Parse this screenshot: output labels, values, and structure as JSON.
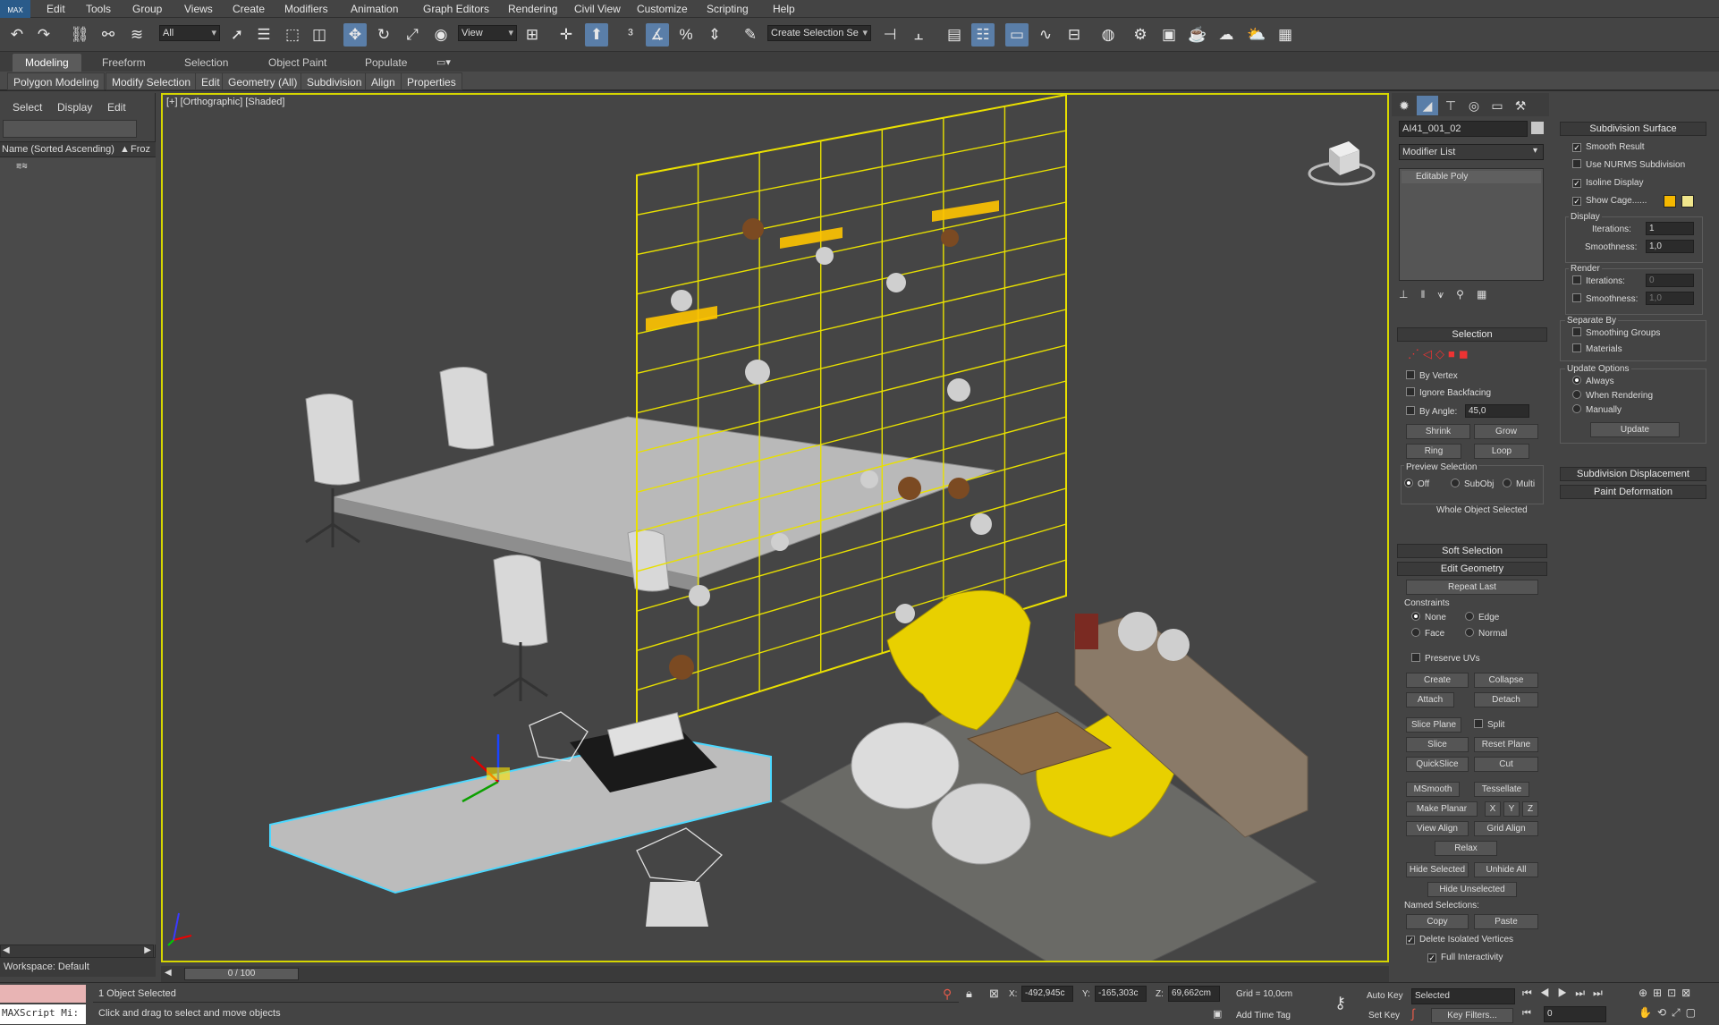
{
  "menu": [
    "Edit",
    "Tools",
    "Group",
    "Views",
    "Create",
    "Modifiers",
    "Animation",
    "Graph Editors",
    "Rendering",
    "Civil View",
    "Customize",
    "Scripting",
    "Help"
  ],
  "app_logo": "MAX",
  "toolbar": {
    "filter": "All",
    "ref_coord": "View",
    "selection_set": "Create Selection Se"
  },
  "ribbon": {
    "tabs": [
      "Modeling",
      "Freeform",
      "Selection",
      "Object Paint",
      "Populate"
    ],
    "items": [
      "Polygon Modeling",
      "Modify Selection",
      "Edit",
      "Geometry (All)",
      "Subdivision",
      "Align",
      "Properties"
    ]
  },
  "scene_explorer": {
    "tabs": [
      "Select",
      "Display",
      "Edit"
    ],
    "col_name": "Name (Sorted Ascending)",
    "col_frozen": "Froz",
    "workspace": "Workspace: Default"
  },
  "viewport": {
    "label": "[+] [Orthographic] [Shaded]",
    "time": "0 / 100"
  },
  "modify": {
    "object_name": "AI41_001_02",
    "modifier_list": "Modifier List",
    "stack_item": "Editable Poly",
    "selection": {
      "title": "Selection",
      "by_vertex": "By Vertex",
      "ignore_backfacing": "Ignore Backfacing",
      "by_angle": "By Angle:",
      "angle": "45,0",
      "shrink": "Shrink",
      "grow": "Grow",
      "ring": "Ring",
      "loop": "Loop",
      "preview": "Preview Selection",
      "off": "Off",
      "subobj": "SubObj",
      "multi": "Multi",
      "status": "Whole Object Selected"
    },
    "soft_selection": "Soft Selection",
    "edit_geometry": {
      "title": "Edit Geometry",
      "repeat_last": "Repeat Last",
      "constraints": "Constraints",
      "none": "None",
      "edge": "Edge",
      "face": "Face",
      "normal": "Normal",
      "preserve_uvs": "Preserve UVs",
      "create": "Create",
      "collapse": "Collapse",
      "attach": "Attach",
      "detach": "Detach",
      "slice_plane": "Slice Plane",
      "split": "Split",
      "slice": "Slice",
      "reset_plane": "Reset Plane",
      "quickslice": "QuickSlice",
      "cut": "Cut",
      "msmooth": "MSmooth",
      "tessellate": "Tessellate",
      "make_planar": "Make Planar",
      "x": "X",
      "y": "Y",
      "z": "Z",
      "view_align": "View Align",
      "grid_align": "Grid Align",
      "relax": "Relax",
      "hide_selected": "Hide Selected",
      "unhide_all": "Unhide All",
      "hide_unselected": "Hide Unselected",
      "named_selections": "Named Selections:",
      "copy": "Copy",
      "paste": "Paste",
      "delete_isolated": "Delete Isolated Vertices",
      "full_interactivity": "Full Interactivity"
    }
  },
  "subdivision": {
    "title": "Subdivision Surface",
    "smooth_result": "Smooth Result",
    "use_nurms": "Use NURMS Subdivision",
    "isoline": "Isoline Display",
    "show_cage": "Show Cage......",
    "display": "Display",
    "iterations_label": "Iterations:",
    "iterations": "1",
    "smoothness_label": "Smoothness:",
    "smoothness": "1,0",
    "render": "Render",
    "r_iterations": "0",
    "r_smoothness": "1,0",
    "separate_by": "Separate By",
    "smoothing_groups": "Smoothing Groups",
    "materials": "Materials",
    "update_options": "Update Options",
    "always": "Always",
    "when_rendering": "When Rendering",
    "manually": "Manually",
    "update": "Update",
    "displacement": "Subdivision Displacement",
    "paint_deformation": "Paint Deformation",
    "cage_colors": [
      "#f5b800",
      "#f0e68c"
    ]
  },
  "status": {
    "selected": "1 Object Selected",
    "prompt": "Click and drag to select and move objects",
    "maxscript": "MAXScript Mi:",
    "x_label": "X:",
    "x": "-492,945c",
    "y_label": "Y:",
    "y": "-165,303c",
    "z_label": "Z:",
    "z": "69,662cm",
    "grid": "Grid = 10,0cm",
    "add_time_tag": "Add Time Tag",
    "auto_key": "Auto Key",
    "set_key": "Set Key",
    "key_mode": "Selected",
    "key_filters": "Key Filters...",
    "frame": "0"
  }
}
